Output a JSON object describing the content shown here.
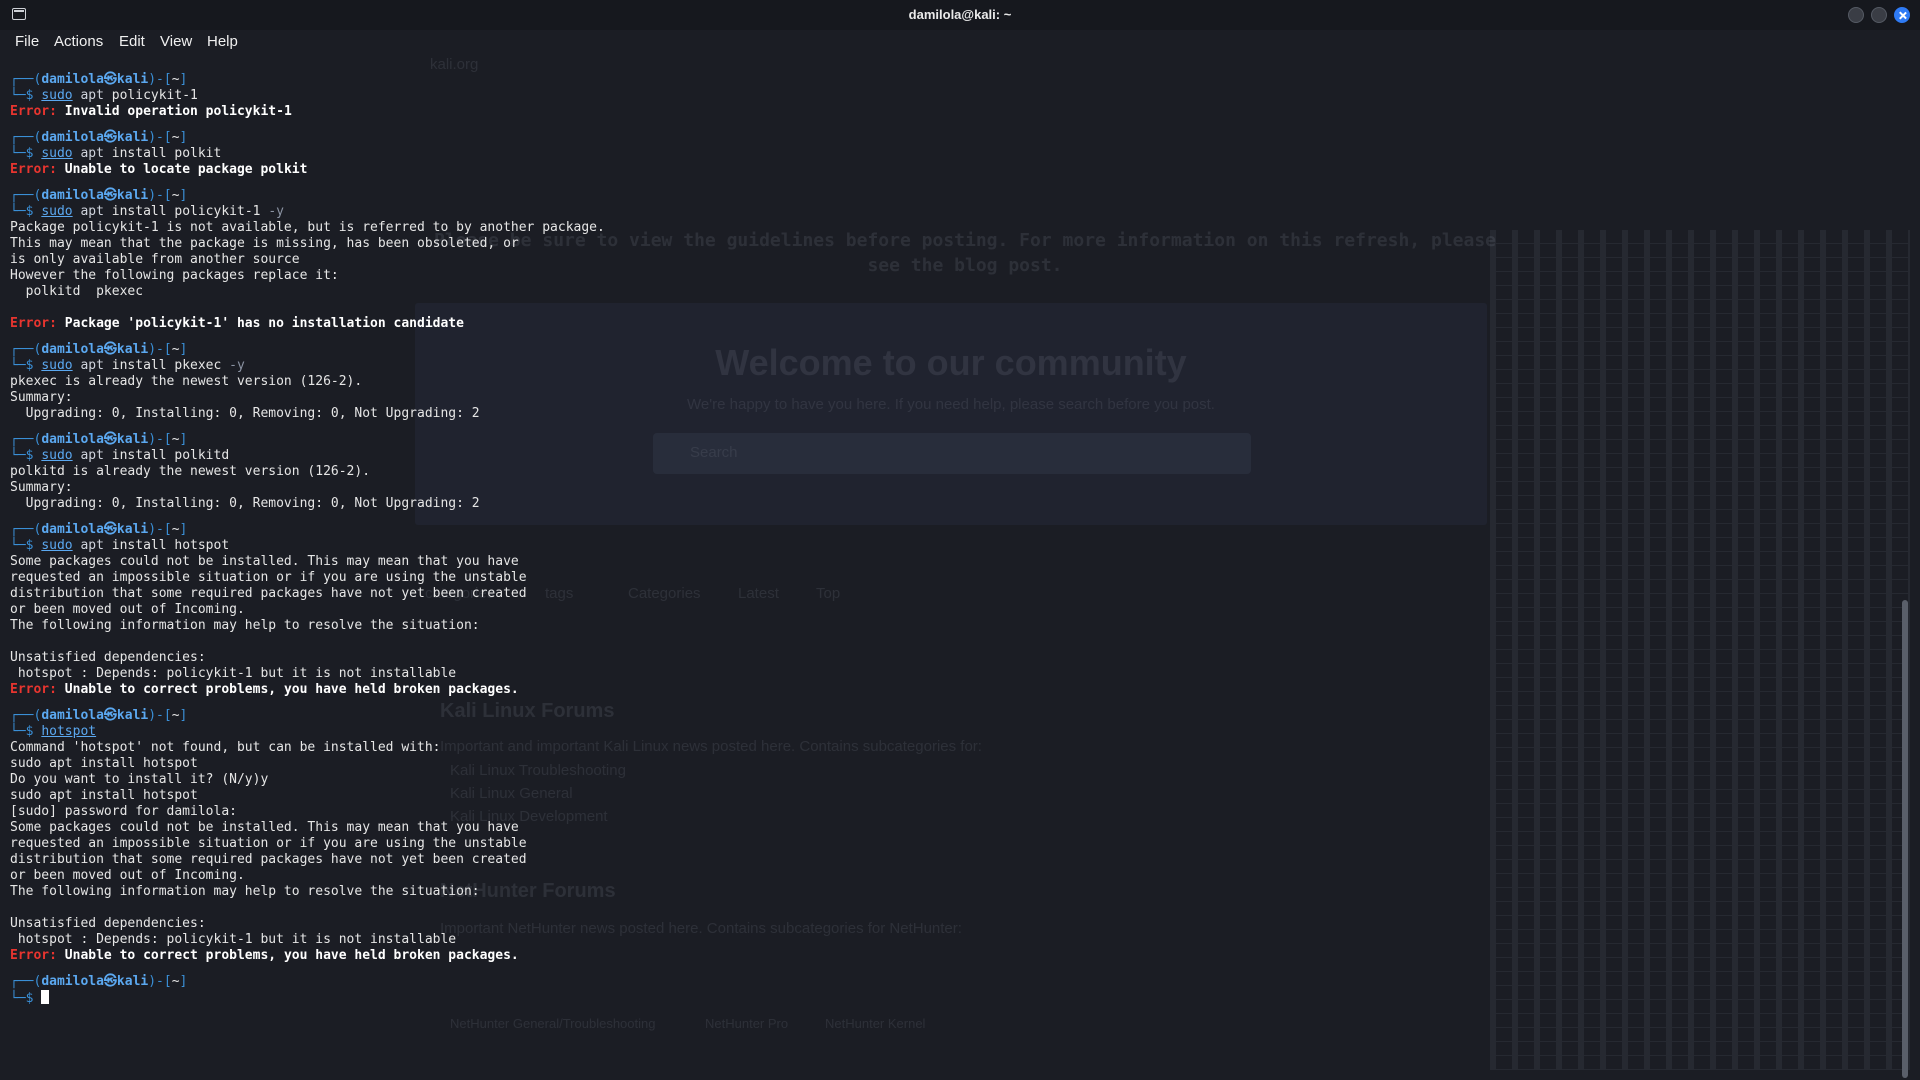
{
  "window": {
    "title": "damilola@kali: ~"
  },
  "menu": [
    "File",
    "Actions",
    "Edit",
    "View",
    "Help"
  ],
  "prompt": {
    "user": "damilola",
    "at": "㉿",
    "host": "kali",
    "dir": "~"
  },
  "background": {
    "url": "kali.org",
    "notice": "Please be sure to view the guidelines before posting. For more information on this refresh, please see the blog post.",
    "welcome": "Welcome to our community",
    "welcome_sub": "We're happy to have you here. If you need help, please search before you post.",
    "search_placeholder": "Search",
    "nav": [
      "categories",
      "tags",
      "Categories",
      "Latest",
      "Top"
    ],
    "cat1_title": "Kali Linux Forums",
    "cat1_desc": "Important and important Kali Linux news posted here. Contains subcategories for:",
    "cat1_subs": [
      "Kali Linux Troubleshooting",
      "Kali Linux General",
      "Kali Linux Development"
    ],
    "cat2_title": "NetHunter Forums",
    "cat2_desc": "Important NetHunter news posted here. Contains subcategories for NetHunter:",
    "cat2_subs": [
      "NetHunter General/Troubleshooting",
      "NetHunter Pro",
      "NetHunter Kernel"
    ]
  },
  "session": [
    {
      "cmd": "sudo",
      "sub": "apt",
      "args": "policykit-1",
      "opt": "",
      "output": [
        {
          "type": "error",
          "text": "Invalid operation policykit-1"
        }
      ]
    },
    {
      "cmd": "sudo",
      "sub": "apt",
      "args": "install polkit",
      "opt": "",
      "output": [
        {
          "type": "error",
          "text": "Unable to locate package polkit"
        }
      ]
    },
    {
      "cmd": "sudo",
      "sub": "apt",
      "args": "install policykit-1",
      "opt": "-y",
      "output": [
        {
          "type": "text",
          "text": "Package policykit-1 is not available, but is referred to by another package."
        },
        {
          "type": "text",
          "text": "This may mean that the package is missing, has been obsoleted, or"
        },
        {
          "type": "text",
          "text": "is only available from another source"
        },
        {
          "type": "text",
          "text": "However the following packages replace it:"
        },
        {
          "type": "text",
          "text": "  polkitd  pkexec"
        },
        {
          "type": "text",
          "text": ""
        },
        {
          "type": "error",
          "text": "Package 'policykit-1' has no installation candidate"
        }
      ]
    },
    {
      "cmd": "sudo",
      "sub": "apt",
      "args": "install pkexec",
      "opt": "-y",
      "output": [
        {
          "type": "text",
          "text": "pkexec is already the newest version (126-2)."
        },
        {
          "type": "text",
          "text": "Summary:"
        },
        {
          "type": "text",
          "text": "  Upgrading: 0, Installing: 0, Removing: 0, Not Upgrading: 2"
        }
      ]
    },
    {
      "cmd": "sudo",
      "sub": "apt",
      "args": "install polkitd",
      "opt": "",
      "output": [
        {
          "type": "text",
          "text": "polkitd is already the newest version (126-2)."
        },
        {
          "type": "text",
          "text": "Summary:"
        },
        {
          "type": "text",
          "text": "  Upgrading: 0, Installing: 0, Removing: 0, Not Upgrading: 2"
        }
      ]
    },
    {
      "cmd": "sudo",
      "sub": "apt",
      "args": "install hotspot",
      "opt": "",
      "output": [
        {
          "type": "text",
          "text": "Some packages could not be installed. This may mean that you have"
        },
        {
          "type": "text",
          "text": "requested an impossible situation or if you are using the unstable"
        },
        {
          "type": "text",
          "text": "distribution that some required packages have not yet been created"
        },
        {
          "type": "text",
          "text": "or been moved out of Incoming."
        },
        {
          "type": "text",
          "text": "The following information may help to resolve the situation:"
        },
        {
          "type": "text",
          "text": ""
        },
        {
          "type": "text",
          "text": "Unsatisfied dependencies:"
        },
        {
          "type": "text",
          "text": " hotspot : Depends: policykit-1 but it is not installable"
        },
        {
          "type": "error",
          "text": "Unable to correct problems, you have held broken packages."
        }
      ]
    },
    {
      "cmd": "hotspot",
      "sub": "",
      "args": "",
      "opt": "",
      "output": [
        {
          "type": "text",
          "text": "Command 'hotspot' not found, but can be installed with:"
        },
        {
          "type": "text",
          "text": "sudo apt install hotspot"
        },
        {
          "type": "text",
          "text": "Do you want to install it? (N/y)y"
        },
        {
          "type": "text",
          "text": "sudo apt install hotspot"
        },
        {
          "type": "text",
          "text": "[sudo] password for damilola:"
        },
        {
          "type": "text",
          "text": "Some packages could not be installed. This may mean that you have"
        },
        {
          "type": "text",
          "text": "requested an impossible situation or if you are using the unstable"
        },
        {
          "type": "text",
          "text": "distribution that some required packages have not yet been created"
        },
        {
          "type": "text",
          "text": "or been moved out of Incoming."
        },
        {
          "type": "text",
          "text": "The following information may help to resolve the situation:"
        },
        {
          "type": "text",
          "text": ""
        },
        {
          "type": "text",
          "text": "Unsatisfied dependencies:"
        },
        {
          "type": "text",
          "text": " hotspot : Depends: policykit-1 but it is not installable"
        },
        {
          "type": "error",
          "text": "Unable to correct problems, you have held broken packages."
        }
      ]
    }
  ],
  "error_label": "Error:",
  "colors": {
    "frame": "#3a8fd6",
    "user": "#5ba8f0",
    "error": "#e8352f",
    "background": "#1b1d24"
  },
  "icons": [
    "terminal-icon",
    "minimize-icon",
    "maximize-icon",
    "close-icon"
  ]
}
